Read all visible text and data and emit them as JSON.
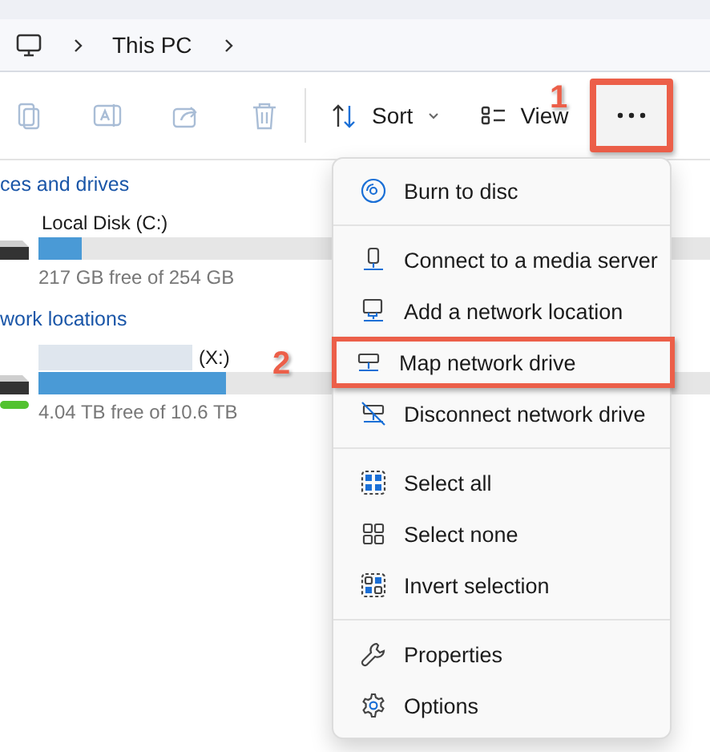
{
  "address_bar": {
    "breadcrumbs": [
      {
        "label": "This PC"
      }
    ]
  },
  "toolbar": {
    "actions": [
      {
        "kind": "copy",
        "disabled": true
      },
      {
        "kind": "rename",
        "disabled": true
      },
      {
        "kind": "share",
        "disabled": true
      },
      {
        "kind": "delete",
        "disabled": true
      }
    ],
    "sort": {
      "label": "Sort"
    },
    "view": {
      "label": "View"
    },
    "more": {
      "annotated": true,
      "callout": "1"
    }
  },
  "groups": [
    {
      "title": "ces and drives",
      "drives": [
        {
          "kind": "local",
          "name": "Local Disk (C:)",
          "redacted": false,
          "level": 0.065,
          "free": "217 GB free of 254 GB"
        }
      ]
    },
    {
      "title": "work locations",
      "drives": [
        {
          "kind": "network",
          "name": "(X:)",
          "redacted": true,
          "level": 0.28,
          "free": "4.04 TB free of 10.6 TB"
        }
      ]
    }
  ],
  "menu": {
    "sections": [
      [
        {
          "kind": "disc",
          "label": "Burn to disc",
          "annotated": false
        }
      ],
      [
        {
          "kind": "media",
          "label": "Connect to a media server",
          "annotated": false
        },
        {
          "kind": "netloc",
          "label": "Add a network location",
          "annotated": false
        },
        {
          "kind": "map",
          "label": "Map network drive",
          "annotated": true,
          "callout": "2"
        },
        {
          "kind": "disconnect",
          "label": "Disconnect network drive",
          "annotated": false
        }
      ],
      [
        {
          "kind": "all",
          "label": "Select all",
          "annotated": false
        },
        {
          "kind": "none",
          "label": "Select none",
          "annotated": false
        },
        {
          "kind": "invert",
          "label": "Invert selection",
          "annotated": false
        }
      ],
      [
        {
          "kind": "wrench",
          "label": "Properties",
          "annotated": false
        },
        {
          "kind": "gear",
          "label": "Options",
          "annotated": false
        }
      ]
    ]
  }
}
